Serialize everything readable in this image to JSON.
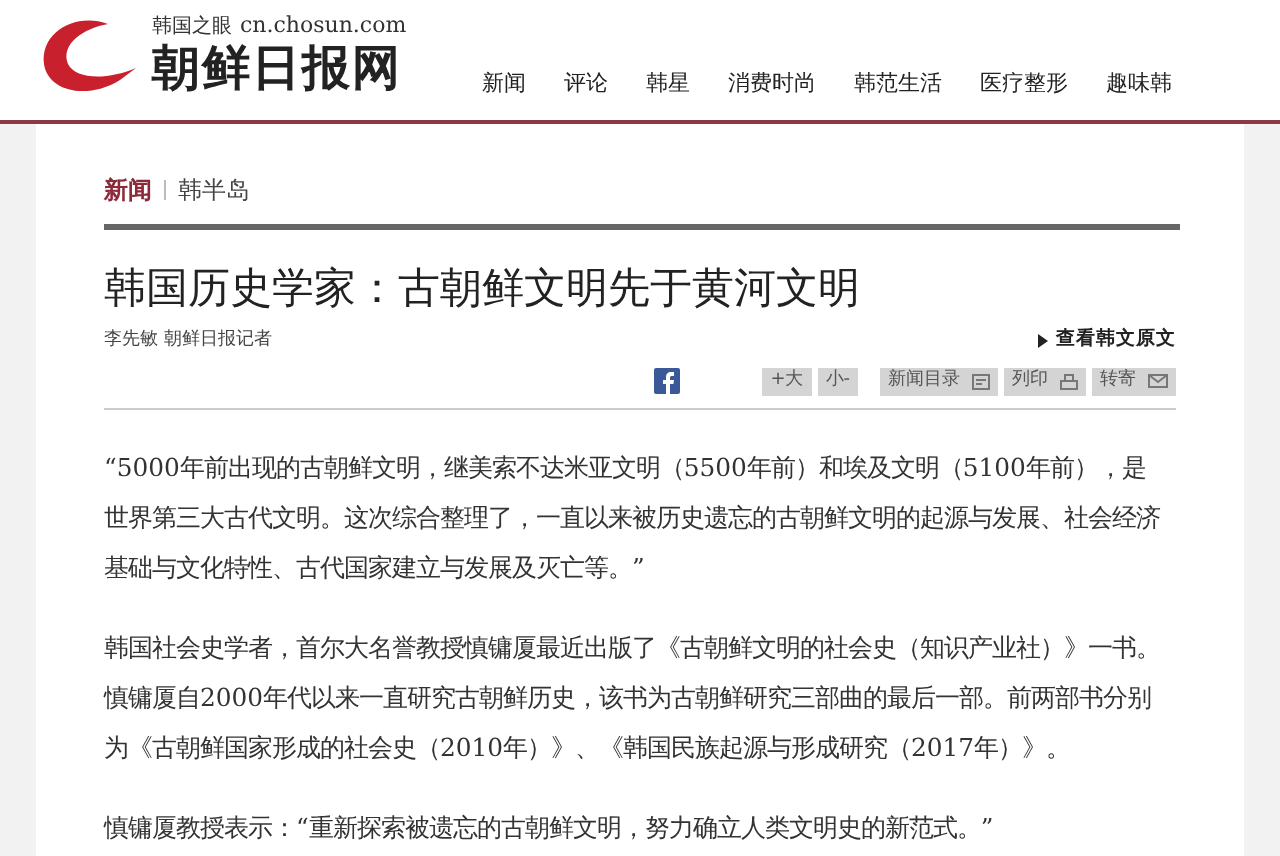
{
  "logo": {
    "tagline": "韩国之眼",
    "domain": "cn.chosun.com",
    "name": "朝鲜日报网"
  },
  "nav": [
    "新闻",
    "评论",
    "韩星",
    "消费时尚",
    "韩范生活",
    "医疗整形",
    "趣味韩"
  ],
  "breadcrumb": [
    {
      "label": "新闻",
      "selected": true
    },
    {
      "label": "韩半岛",
      "selected": false
    }
  ],
  "article": {
    "title": "韩国历史学家：古朝鲜文明先于黄河文明",
    "byline": "李先敏  朝鲜日报记者",
    "original_link": "查看韩文原文",
    "tools": [
      {
        "label": "+大",
        "kind": "plain"
      },
      {
        "label": "小-",
        "kind": "plain"
      },
      {
        "label": "新闻目录",
        "kind": "doc"
      },
      {
        "label": "列印",
        "kind": "print"
      },
      {
        "label": "转寄",
        "kind": "mail"
      }
    ],
    "paragraphs": [
      "“5000年前出现的古朝鲜文明，继美索不达米亚文明（5500年前）和埃及文明（5100年前），是世界第三大古代文明。这次综合整理了，一直以来被历史遗忘的古朝鲜文明的起源与发展、社会经济基础与文化特性、古代国家建立与发展及灭亡等。”",
      "韩国社会史学者，首尔大名誉教授慎镛厦最近出版了《古朝鲜文明的社会史（知识产业社）》一书。慎镛厦自2000年代以来一直研究古朝鲜历史，该书为古朝鲜研究三部曲的最后一部。前两部书分别为《古朝鲜国家形成的社会史（2010年）》、《韩国民族起源与形成研究（2017年）》。",
      "慎镛厦教授表示：“重新探索被遗忘的古朝鲜文明，努力确立人类文明史的新范式。”"
    ]
  }
}
